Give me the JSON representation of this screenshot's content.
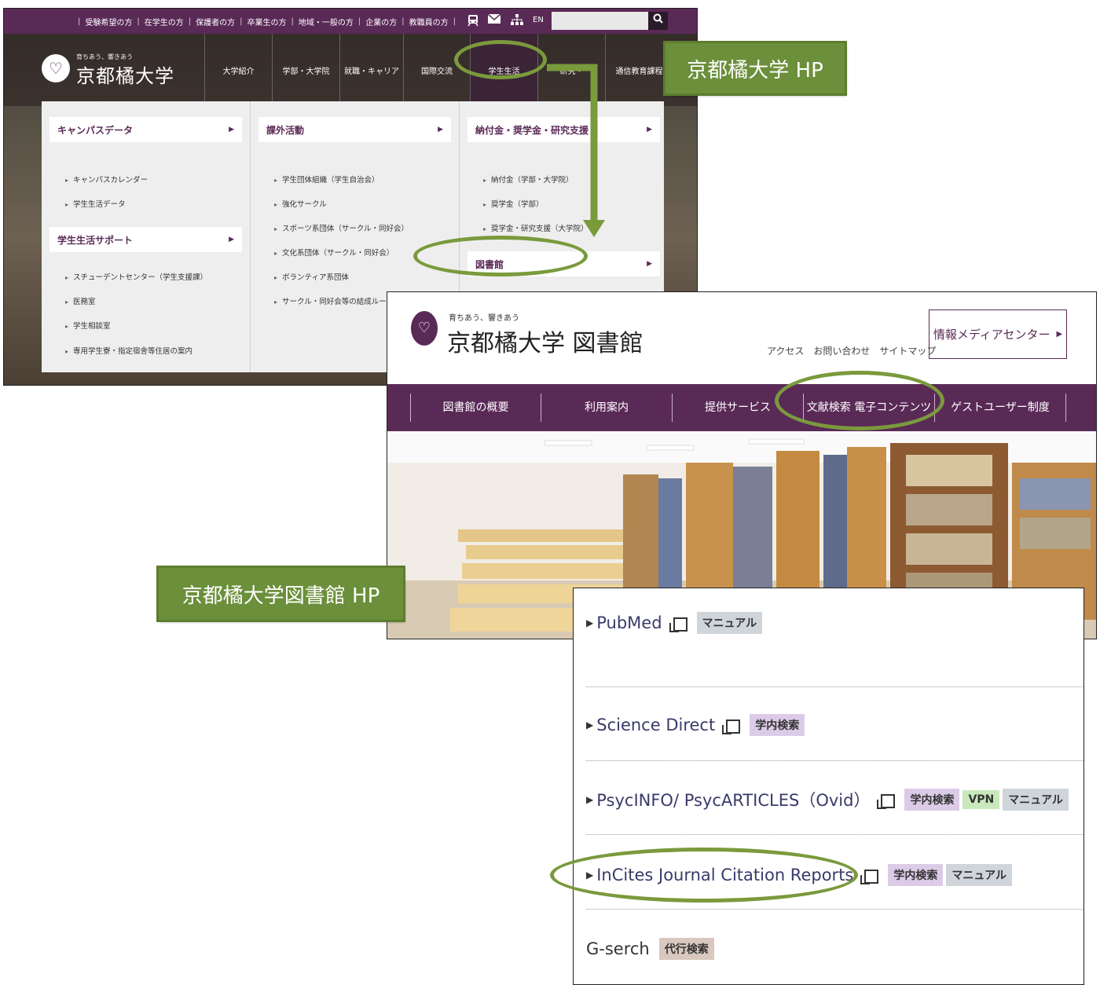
{
  "university_site": {
    "util_nav": [
      "受験希望の方",
      "在学生の方",
      "保護者の方",
      "卒業生の方",
      "地域・一般の方",
      "企業の方",
      "教職員の方"
    ],
    "util_icons": [
      "train-icon",
      "mail-icon",
      "sitemap-icon"
    ],
    "lang_label": "EN",
    "logo_tagline": "育ちあう、響きあう",
    "logo_text": "京都橘大学",
    "main_nav": [
      "大学紹介",
      "学部・大学院",
      "就職・キャリア",
      "国際交流",
      "学生生活",
      "研究・",
      "通信教育課程"
    ],
    "menu": {
      "col1": {
        "cat1": "キャンパスデータ",
        "cat1_items": [
          "キャンパスカレンダー",
          "学生生活データ"
        ],
        "cat2": "学生生活サポート",
        "cat2_items": [
          "スチューデントセンター（学生支援課）",
          "医務室",
          "学生相談室",
          "専用学生寮・指定宿舎等住居の案内"
        ]
      },
      "col2": {
        "cat1": "課外活動",
        "cat1_items": [
          "学生団体組織（学生自治会）",
          "強化サークル",
          "スポーツ系団体（サークル・同好会）",
          "文化系団体（サークル・同好会）",
          "ボランティア系団体",
          "サークル・同好会等の結成ルー"
        ]
      },
      "col3": {
        "cat1": "納付金・奨学金・研究支援",
        "cat1_items": [
          "納付金（学部・大学院）",
          "奨学金（学部）",
          "奨学金・研究支援（大学院）"
        ],
        "cat2": "図書館"
      }
    }
  },
  "library_site": {
    "tagline": "育ちあう、響きあう",
    "title": "京都橘大学 図書館",
    "header_links": [
      "アクセス",
      "お問い合わせ",
      "サイトマップ"
    ],
    "media_center": "情報メディアセンター",
    "nav": [
      "図書館の概要",
      "利用案内",
      "提供サービス",
      "文献検索 電子コンテンツ",
      "ゲストユーザー制度"
    ]
  },
  "databases": [
    {
      "name": "PubMed",
      "badges": [
        {
          "label": "マニュアル",
          "color": "grey"
        }
      ]
    },
    {
      "name": "Science Direct",
      "badges": [
        {
          "label": "学内検索",
          "color": "purple"
        }
      ]
    },
    {
      "name": "PsycINFO/ PsycARTICLES（Ovid）",
      "badges": [
        {
          "label": "学内検索",
          "color": "purple"
        },
        {
          "label": "VPN",
          "color": "green"
        },
        {
          "label": "マニュアル",
          "color": "grey"
        }
      ]
    },
    {
      "name": "InCites Journal Citation Reports",
      "badges": [
        {
          "label": "学内検索",
          "color": "purple"
        },
        {
          "label": "マニュアル",
          "color": "grey"
        }
      ]
    },
    {
      "name": "G-serch",
      "badges": [
        {
          "label": "代行検索",
          "color": "tan"
        }
      ]
    }
  ],
  "callouts": {
    "university": "京都橘大学 HP",
    "library": "京都橘大学図書館 HP"
  },
  "colors": {
    "brand_purple": "#5a2a57",
    "callout_green": "#6b8f3a",
    "annotation_green": "#7a9a3c"
  }
}
